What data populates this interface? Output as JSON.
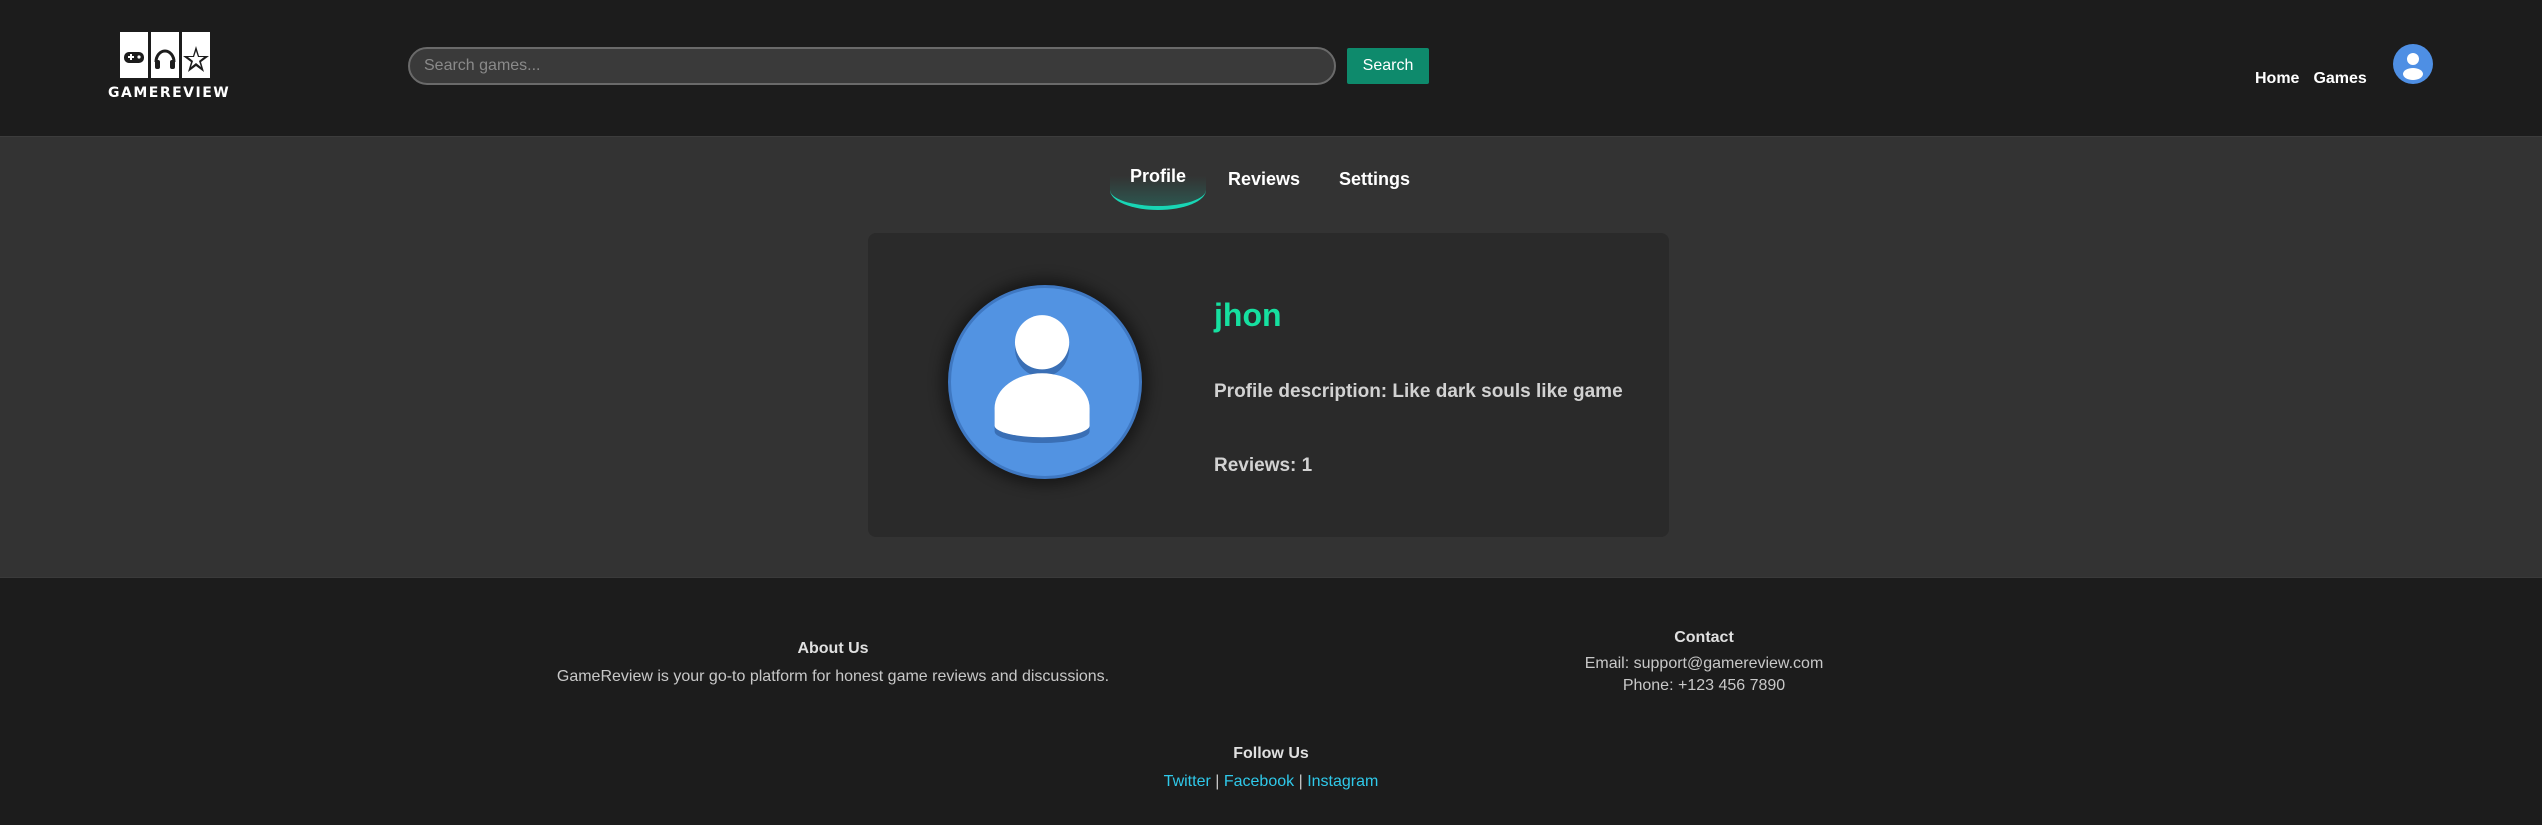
{
  "header": {
    "logo_text": "GAMEREVIEW",
    "search_placeholder": "Search games...",
    "search_button": "Search",
    "nav": {
      "home": "Home",
      "games": "Games"
    }
  },
  "tabs": [
    {
      "label": "Profile",
      "active": true
    },
    {
      "label": "Reviews",
      "active": false
    },
    {
      "label": "Settings",
      "active": false
    }
  ],
  "profile": {
    "username": "jhon",
    "description": "Profile description: Like dark souls like game",
    "reviews": "Reviews: 1"
  },
  "footer": {
    "about": {
      "title": "About Us",
      "text": "GameReview is your go-to platform for honest game reviews and discussions."
    },
    "contact": {
      "title": "Contact",
      "email": "Email: support@gamereview.com",
      "phone": "Phone: +123 456 7890"
    },
    "follow": {
      "title": "Follow Us",
      "links": [
        "Twitter",
        "Facebook",
        "Instagram"
      ],
      "separator": "|"
    }
  },
  "colors": {
    "accent_green": "#16e0a0",
    "search_button": "#0e8a6c",
    "tab_underline": "#18d6b5",
    "avatar_blue": "#5293e2",
    "link_cyan": "#2fc9ea"
  },
  "icons": [
    "gamereview-logo",
    "user-avatar-icon",
    "profile-avatar-icon"
  ]
}
